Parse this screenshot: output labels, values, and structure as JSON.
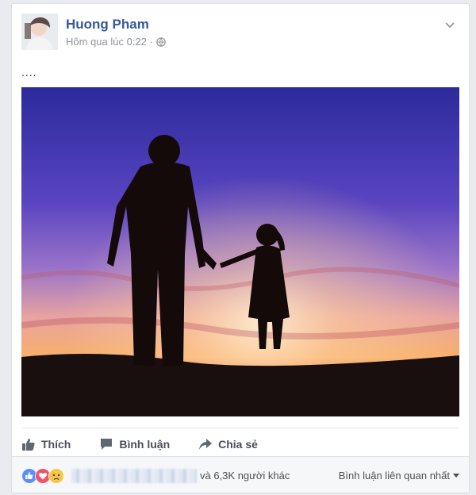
{
  "post": {
    "author": "Huong Pham",
    "timestamp": "Hôm qua lúc 0:22 ·",
    "privacy_icon": "globe-icon",
    "text": "...."
  },
  "actions": {
    "like": "Thích",
    "comment": "Bình luận",
    "share": "Chia sẻ"
  },
  "reactions": {
    "icons": [
      "like-icon",
      "love-icon",
      "sad-icon"
    ],
    "others": "và 6,3K người khác",
    "sort_label": "Bình luận liên quan nhất"
  },
  "colors": {
    "link": "#365899",
    "like": "#5890ff",
    "love": "#f25268",
    "sad": "#f7c74c"
  }
}
